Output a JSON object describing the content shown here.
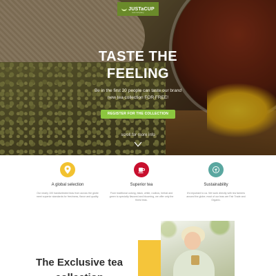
{
  "logo": {
    "text": "JUSTaCUP",
    "sub": "tea company"
  },
  "hero": {
    "title_line1": "TASTE THE",
    "title_line2": "FEELING",
    "subtitle_line1": "Be in the first 20 people can taste our brand",
    "subtitle_line2": "new tea collection FOR FREE!",
    "cta_label": "REGISTER FOR THE COLLECTION",
    "scroll_label": "scroll for more info"
  },
  "features": [
    {
      "icon": "location-pin-icon",
      "color": "#f2c230",
      "title": "A global selection",
      "desc": "Our nearly 100 handselected teas from across the globe meet superior standards for freshness, flavor and quality."
    },
    {
      "icon": "tea-cup-icon",
      "color": "#c8102e",
      "title": "Superior tea",
      "desc": "From traditional oolong, black, white, rooibos, herbal and green to specialty flavored and blooming, we offer only the finest teas."
    },
    {
      "icon": "leaf-badge-icon",
      "color": "#5aa7a0",
      "title": "Sustainability",
      "desc": "It's important to us. We work directly with tea farmers around the globe; most of our teas are Fair Trade and Organic."
    }
  ],
  "bottom": {
    "heading": "The Exclusive tea collection"
  },
  "colors": {
    "accent_green": "#8cc63f",
    "accent_yellow": "#f5c53a"
  }
}
